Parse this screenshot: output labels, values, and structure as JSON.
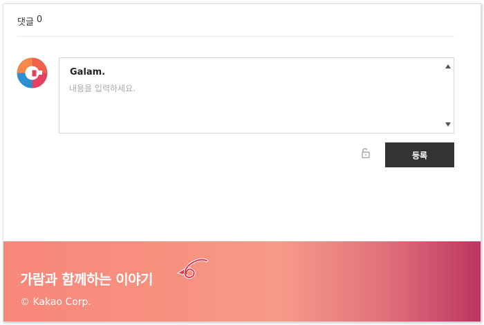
{
  "comments": {
    "label": "댓글",
    "count": "0"
  },
  "editor": {
    "author": "Galam.",
    "placeholder": "내용을 입력하세요."
  },
  "actions": {
    "lock_icon": "unlock-icon",
    "submit_label": "등록"
  },
  "footer": {
    "title": "가람과 함께하는 이야기",
    "copyright": "© Kakao Corp."
  },
  "colors": {
    "submit_bg": "#333333",
    "footer_gradient_start": "#f8877a",
    "footer_gradient_end": "#bb3561"
  }
}
